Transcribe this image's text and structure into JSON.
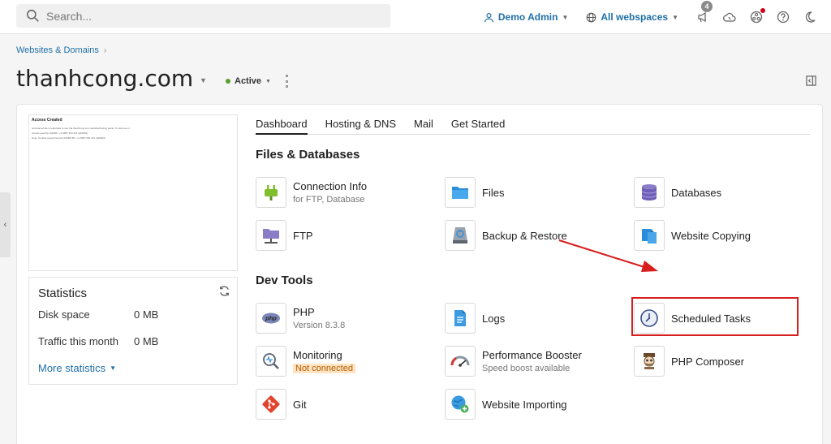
{
  "topbar": {
    "search_placeholder": "Search...",
    "user_label": "Demo Admin",
    "webspaces_label": "All webspaces",
    "notifications_count": "4"
  },
  "breadcrumb": {
    "item": "Websites & Domains"
  },
  "header": {
    "title": "thanhcong.com",
    "status": "Active"
  },
  "preview": {
    "title": "Access Created",
    "lines": [
      "Hostname/User credentials to use the thanhcong.com website/hosting panel. To start use it.",
      "Access user/ftp 123456 / +1 0987 654 321 (ADMIN)",
      "Note: Contact support/email 123456789 / +1 0987 654 321 (ADMIN)"
    ]
  },
  "stats": {
    "title": "Statistics",
    "disk_label": "Disk space",
    "disk_value": "0 MB",
    "traffic_label": "Traffic this month",
    "traffic_value": "0 MB",
    "more": "More statistics"
  },
  "tabs": [
    "Dashboard",
    "Hosting & DNS",
    "Mail",
    "Get Started"
  ],
  "sections": {
    "files": "Files & Databases",
    "dev": "Dev Tools"
  },
  "tools": {
    "connection_info": {
      "name": "Connection Info",
      "sub": "for FTP, Database",
      "icon": "plug-icon"
    },
    "files": {
      "name": "Files",
      "icon": "folder-icon"
    },
    "databases": {
      "name": "Databases",
      "icon": "database-icon"
    },
    "ftp": {
      "name": "FTP",
      "icon": "ftp-icon"
    },
    "backup": {
      "name": "Backup & Restore",
      "icon": "backup-icon"
    },
    "website_copying": {
      "name": "Website Copying",
      "icon": "copy-icon"
    },
    "php": {
      "name": "PHP",
      "sub": "Version 8.3.8",
      "icon": "php-icon"
    },
    "logs": {
      "name": "Logs",
      "icon": "logs-icon"
    },
    "scheduled_tasks": {
      "name": "Scheduled Tasks",
      "icon": "clock-icon"
    },
    "monitoring": {
      "name": "Monitoring",
      "badge": "Not connected",
      "icon": "monitoring-icon"
    },
    "performance": {
      "name": "Performance Booster",
      "sub": "Speed boost available",
      "icon": "gauge-icon"
    },
    "composer": {
      "name": "PHP Composer",
      "icon": "composer-icon"
    },
    "git": {
      "name": "Git",
      "icon": "git-icon"
    },
    "importing": {
      "name": "Website Importing",
      "icon": "globe-add-icon"
    }
  },
  "colors": {
    "link": "#1f6fa8",
    "active_status": "#5aa02c",
    "highlight": "#d81d1d",
    "warning_bg": "#ffe3c2"
  }
}
